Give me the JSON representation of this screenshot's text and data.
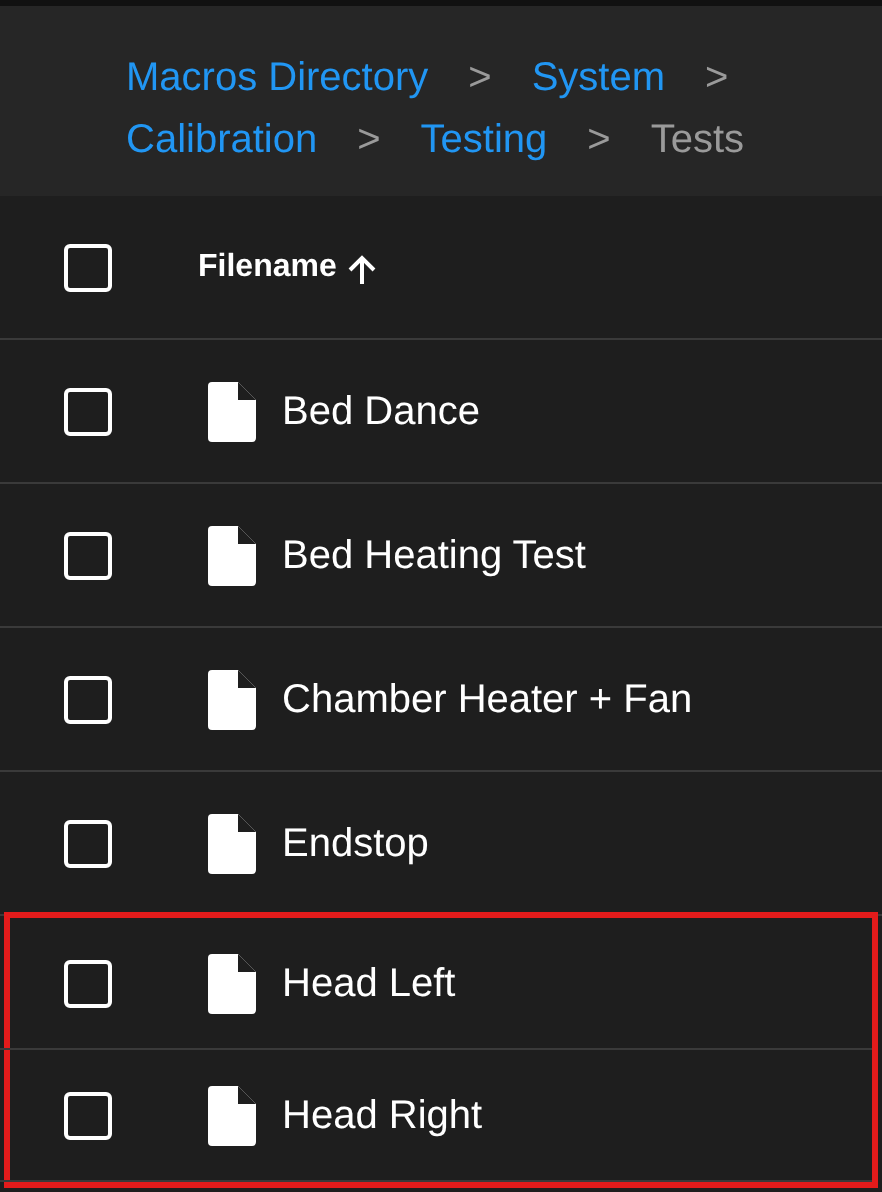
{
  "breadcrumbs": [
    {
      "label": "Macros Directory",
      "current": false
    },
    {
      "label": "System",
      "current": false
    },
    {
      "label": "Calibration",
      "current": false
    },
    {
      "label": "Testing",
      "current": false
    },
    {
      "label": "Tests",
      "current": true
    }
  ],
  "separator": ">",
  "table": {
    "header": {
      "checked": false,
      "column": "Filename",
      "sort_ascending": true
    },
    "rows": [
      {
        "name": "Bed Dance",
        "checked": false,
        "highlighted": false
      },
      {
        "name": "Bed Heating Test",
        "checked": false,
        "highlighted": false
      },
      {
        "name": "Chamber Heater + Fan",
        "checked": false,
        "highlighted": false
      },
      {
        "name": "Endstop",
        "checked": false,
        "highlighted": false
      },
      {
        "name": "Head Left",
        "checked": false,
        "highlighted": true
      },
      {
        "name": "Head Right",
        "checked": false,
        "highlighted": true
      }
    ]
  }
}
